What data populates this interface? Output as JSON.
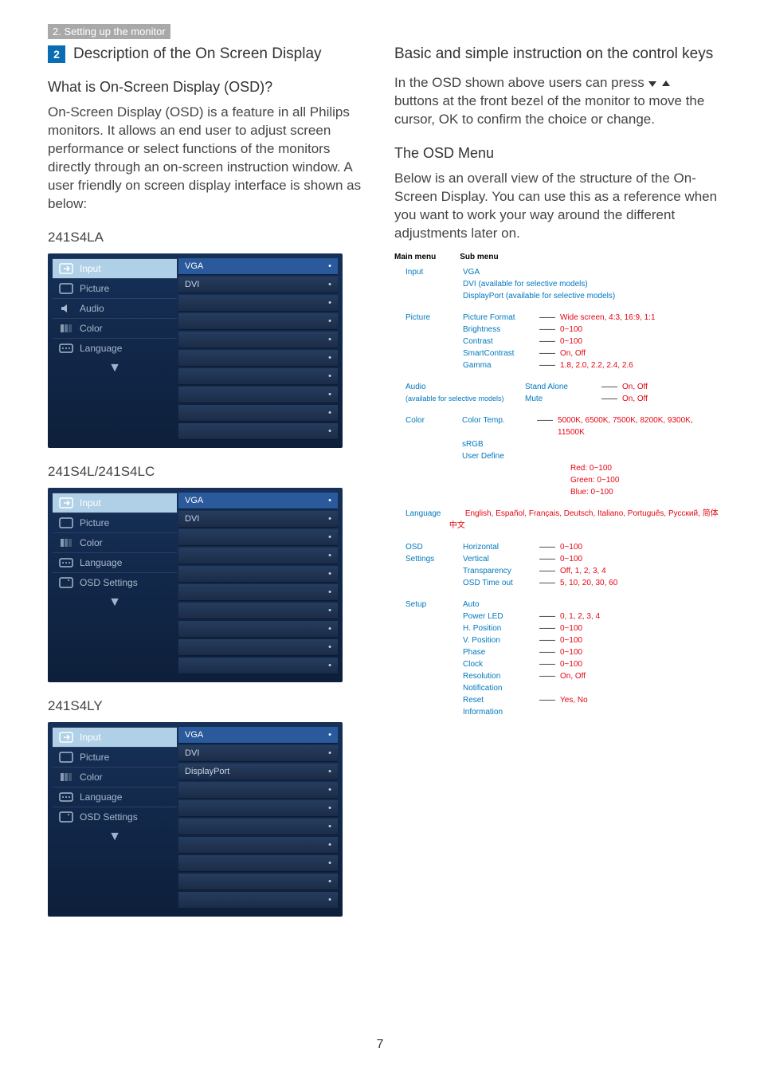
{
  "breadcrumb": "2. Setting up the monitor",
  "step_number": "2",
  "section_title": "Description of the On Screen Display",
  "left": {
    "what_heading": "What is On-Screen Display (OSD)?",
    "what_body": "On-Screen Display (OSD) is a feature in all Philips monitors. It allows an end user to adjust screen performance or select functions of the monitors directly through an on-screen instruction window. A user friendly on screen display interface is shown as below:",
    "models": {
      "a": "241S4LA",
      "b": "241S4L/241S4LC",
      "c": "241S4LY"
    },
    "osd_a_items": [
      "Input",
      "Picture",
      "Audio",
      "Color",
      "Language"
    ],
    "osd_b_items": [
      "Input",
      "Picture",
      "Color",
      "Language",
      "OSD Settings"
    ],
    "osd_c_items": [
      "Input",
      "Picture",
      "Color",
      "Language",
      "OSD Settings"
    ],
    "osd_a_right_first": [
      "VGA",
      "DVI"
    ],
    "osd_c_right_first": [
      "VGA",
      "DVI",
      "DisplayPort"
    ]
  },
  "right": {
    "basic_heading": "Basic and simple instruction on the control keys",
    "basic_body_1": "In the OSD shown above users can press ",
    "basic_body_2": " buttons at the front bezel of the monitor to move the cursor, ",
    "basic_body_ok": "OK",
    "basic_body_3": " to confirm the choice or change.",
    "osd_menu_heading": "The OSD Menu",
    "osd_menu_body": "Below is an overall view of the structure of the On-Screen Display. You can use this as a reference when you want to work your way around the different adjustments later on.",
    "tree_head_main": "Main menu",
    "tree_head_sub": "Sub menu",
    "tree": {
      "input": {
        "label": "Input",
        "items": [
          "VGA",
          "DVI (available for selective models)",
          "DisplayPort (available for selective models)"
        ]
      },
      "picture": {
        "label": "Picture",
        "items": [
          {
            "l": "Picture Format",
            "v": "Wide screen, 4:3, 16:9, 1:1"
          },
          {
            "l": "Brightness",
            "v": "0~100"
          },
          {
            "l": "Contrast",
            "v": "0~100"
          },
          {
            "l": "SmartContrast",
            "v": "On, Off"
          },
          {
            "l": "Gamma",
            "v": "1.8, 2.0, 2.2, 2.4, 2.6"
          }
        ]
      },
      "audio": {
        "label": "Audio",
        "note": "(available for selective models)",
        "items": [
          {
            "l": "Stand Alone",
            "v": "On, Off"
          },
          {
            "l": "Mute",
            "v": "On, Off"
          }
        ]
      },
      "color": {
        "label": "Color",
        "items": [
          {
            "l": "Color Temp.",
            "v": "5000K, 6500K, 7500K, 8200K, 9300K, 11500K"
          },
          {
            "l": "sRGB",
            "v": ""
          },
          {
            "l": "User Define",
            "sub": [
              "Red: 0~100",
              "Green: 0~100",
              "Blue: 0~100"
            ]
          }
        ]
      },
      "language": {
        "label": "Language",
        "value": "English, Español, Français, Deutsch, Italiano, Português, Русский, 简体中文"
      },
      "osd_settings": {
        "label": "OSD Settings",
        "items": [
          {
            "l": "Horizontal",
            "v": "0~100"
          },
          {
            "l": "Vertical",
            "v": "0~100"
          },
          {
            "l": "Transparency",
            "v": "Off, 1, 2, 3, 4"
          },
          {
            "l": "OSD Time out",
            "v": "5, 10, 20, 30, 60"
          }
        ]
      },
      "setup": {
        "label": "Setup",
        "items": [
          {
            "l": "Auto",
            "v": ""
          },
          {
            "l": "Power LED",
            "v": "0, 1, 2, 3, 4"
          },
          {
            "l": "H. Position",
            "v": "0~100"
          },
          {
            "l": "V. Position",
            "v": "0~100"
          },
          {
            "l": "Phase",
            "v": "0~100"
          },
          {
            "l": "Clock",
            "v": "0~100"
          },
          {
            "l": "Resolution Notification",
            "v": "On, Off"
          },
          {
            "l": "Reset",
            "v": "Yes, No"
          },
          {
            "l": "Information",
            "v": ""
          }
        ]
      }
    }
  },
  "page_number": "7"
}
